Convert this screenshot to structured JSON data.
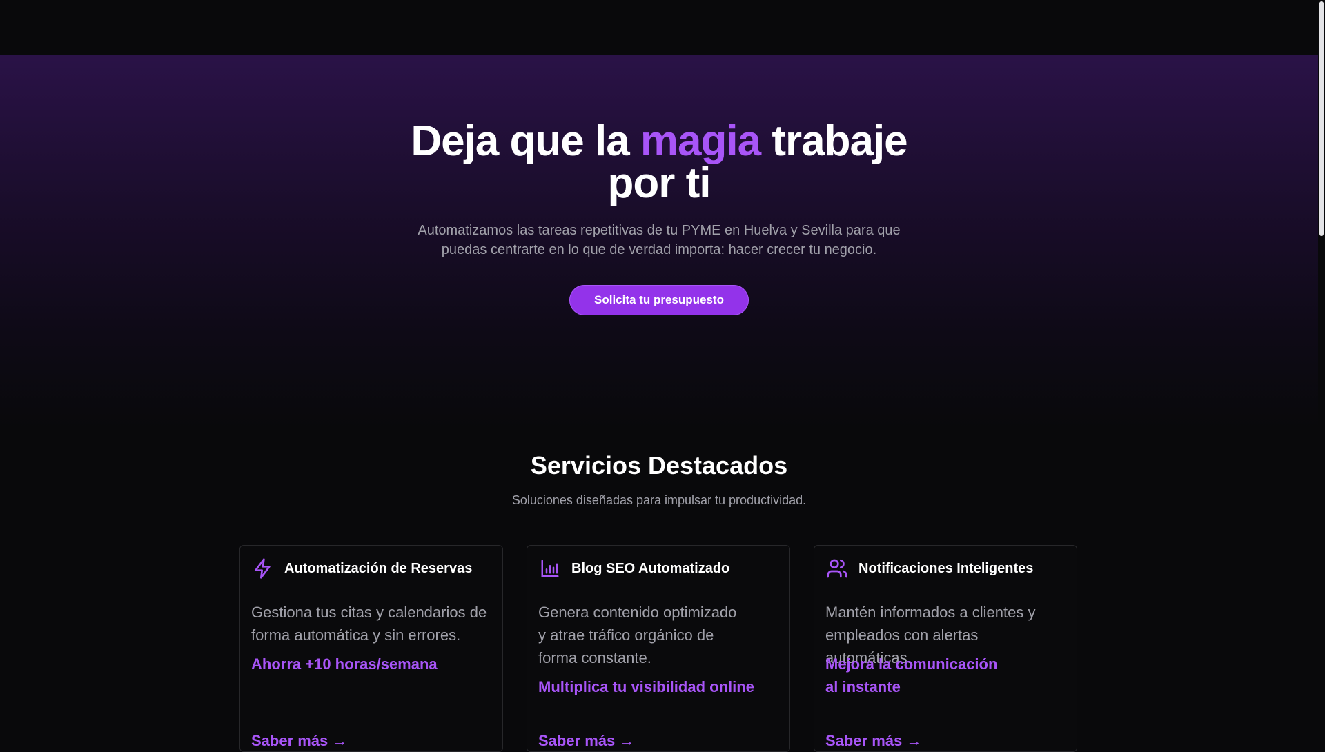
{
  "hero": {
    "title_before": "Deja que la ",
    "title_accent": "magia",
    "title_after": " trabaje por ti",
    "subtitle": "Automatizamos las tareas repetitivas de tu PYME en Huelva y Sevilla para que puedas centrarte en lo que de verdad importa: hacer crecer tu negocio.",
    "cta_label": "Solicita tu presupuesto"
  },
  "services": {
    "title": "Servicios Destacados",
    "subtitle": "Soluciones diseñadas para impulsar tu productividad.",
    "cards": [
      {
        "icon": "lightning-icon",
        "title": "Automatización de Reservas",
        "description": "Gestiona tus citas y calendarios de forma automática y sin errores.",
        "benefit": "Ahorra +10 horas/semana",
        "link": "Saber más →"
      },
      {
        "icon": "bar-chart-icon",
        "title": "Blog SEO Automatizado",
        "description": "Genera contenido optimizado y atrae tráfico orgánico de forma constante.",
        "benefit": "Multiplica tu visibilidad online",
        "link": "Saber más →"
      },
      {
        "icon": "users-icon",
        "title": "Notificaciones Inteligentes",
        "description": "Mantén informados a clientes y empleados con alertas automáticas.",
        "benefit": "Mejora la comunicación al instante",
        "link": "Saber más →"
      }
    ]
  },
  "colors": {
    "accent": "#a855f7",
    "button": "#9333ea",
    "background": "#09090b"
  }
}
